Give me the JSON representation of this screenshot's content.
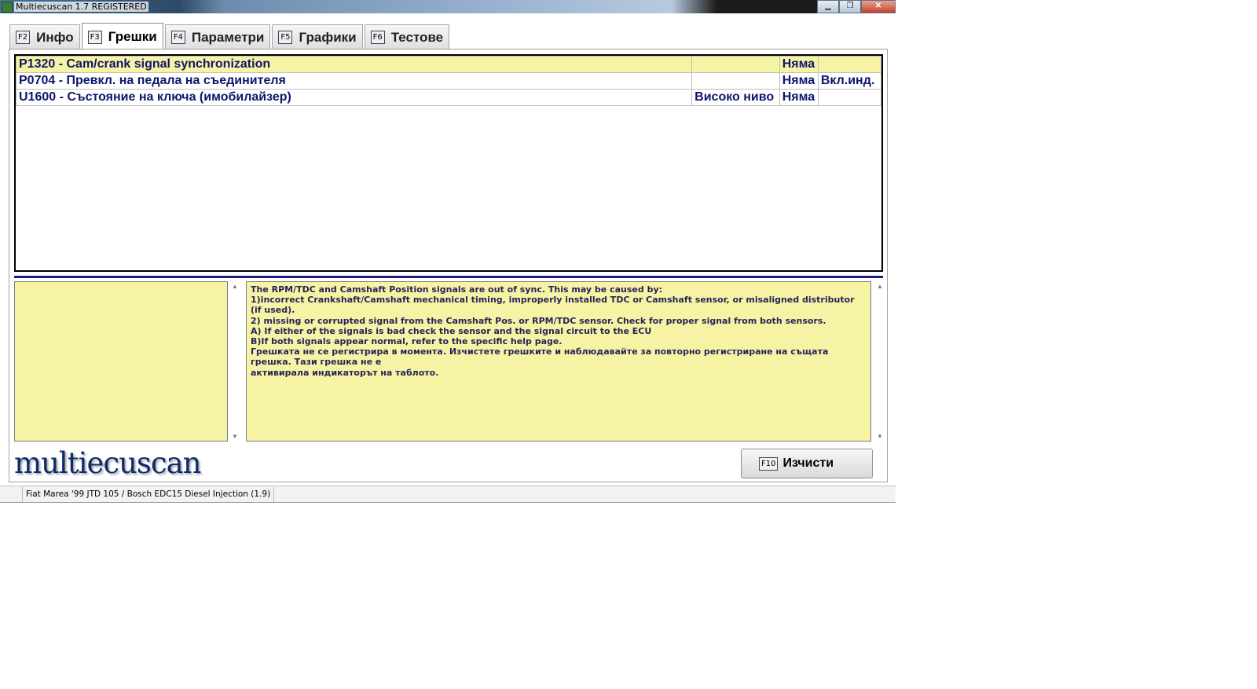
{
  "window": {
    "title": "Multiecuscan 1.7 REGISTERED",
    "buttons": {
      "minimize": "▁",
      "restore": "❐",
      "close": "✕"
    }
  },
  "tabs": [
    {
      "key": "F2",
      "label": "Инфо"
    },
    {
      "key": "F3",
      "label": "Грешки",
      "active": true
    },
    {
      "key": "F4",
      "label": "Параметри"
    },
    {
      "key": "F5",
      "label": "Графики"
    },
    {
      "key": "F6",
      "label": "Тестове"
    }
  ],
  "faults": [
    {
      "code": "P1320 - Cam/crank signal synchronization",
      "level": "",
      "status": "Няма",
      "indicator": "",
      "selected": true
    },
    {
      "code": "P0704 - Превкл. на педала на съединителя",
      "level": "",
      "status": "Няма",
      "indicator": "Вкл.инд."
    },
    {
      "code": "U1600 - Състояние на ключа (имобилайзер)",
      "level": "Високо ниво",
      "status": "Няма",
      "indicator": ""
    }
  ],
  "description": [
    "The RPM/TDC and Camshaft Position signals are out of sync. This may be caused by:",
    "1)incorrect Crankshaft/Camshaft mechanical timing, improperly installed TDC or Camshaft sensor, or misaligned distributor (if used).",
    "2) missing or corrupted signal from the Camshaft Pos. or RPM/TDC sensor. Check for proper signal from both sensors.",
    "A) If either of the signals is bad check the sensor and the signal circuit to the ECU",
    "B)If both signals appear normal, refer to the specific help page.",
    "Грешката не се регистрира в момента. Изчистете грешките и наблюдавайте за повторно регистриране на същата грешка. Тази грешка не е",
    "активирала индикаторът на таблото."
  ],
  "logo": "multiecuscan",
  "clear_button": {
    "key": "F10",
    "label": "Изчисти"
  },
  "status_bar": {
    "vehicle": "Fiat Marea '99 JTD 105 / Bosch EDC15 Diesel Injection (1.9)"
  },
  "colors": {
    "highlight": "#f7f3a4",
    "fault_text": "#0e166b",
    "separator": "#1c1f7a"
  }
}
